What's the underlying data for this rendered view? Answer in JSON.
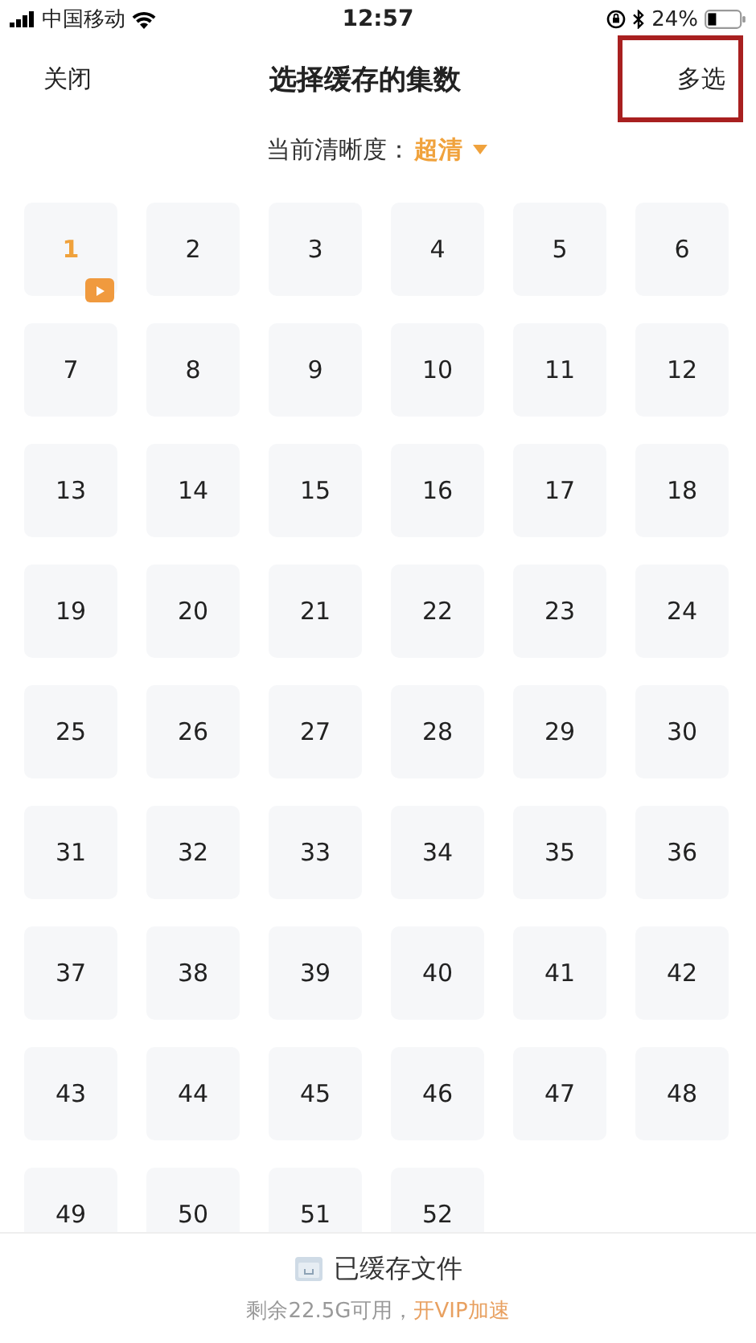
{
  "status_bar": {
    "carrier": "中国移动",
    "time": "12:57",
    "battery": "24%"
  },
  "header": {
    "close": "关闭",
    "title": "选择缓存的集数",
    "multi_select": {
      "label": "多选",
      "highlighted": true
    }
  },
  "quality": {
    "label": "当前清晰度：",
    "value": "超清"
  },
  "episodes": [
    {
      "label": "1",
      "playing": true
    },
    {
      "label": "2",
      "playing": false
    },
    {
      "label": "3",
      "playing": false
    },
    {
      "label": "4",
      "playing": false
    },
    {
      "label": "5",
      "playing": false
    },
    {
      "label": "6",
      "playing": false
    },
    {
      "label": "7",
      "playing": false
    },
    {
      "label": "8",
      "playing": false
    },
    {
      "label": "9",
      "playing": false
    },
    {
      "label": "10",
      "playing": false
    },
    {
      "label": "11",
      "playing": false
    },
    {
      "label": "12",
      "playing": false
    },
    {
      "label": "13",
      "playing": false
    },
    {
      "label": "14",
      "playing": false
    },
    {
      "label": "15",
      "playing": false
    },
    {
      "label": "16",
      "playing": false
    },
    {
      "label": "17",
      "playing": false
    },
    {
      "label": "18",
      "playing": false
    },
    {
      "label": "19",
      "playing": false
    },
    {
      "label": "20",
      "playing": false
    },
    {
      "label": "21",
      "playing": false
    },
    {
      "label": "22",
      "playing": false
    },
    {
      "label": "23",
      "playing": false
    },
    {
      "label": "24",
      "playing": false
    },
    {
      "label": "25",
      "playing": false
    },
    {
      "label": "26",
      "playing": false
    },
    {
      "label": "27",
      "playing": false
    },
    {
      "label": "28",
      "playing": false
    },
    {
      "label": "29",
      "playing": false
    },
    {
      "label": "30",
      "playing": false
    },
    {
      "label": "31",
      "playing": false
    },
    {
      "label": "32",
      "playing": false
    },
    {
      "label": "33",
      "playing": false
    },
    {
      "label": "34",
      "playing": false
    },
    {
      "label": "35",
      "playing": false
    },
    {
      "label": "36",
      "playing": false
    },
    {
      "label": "37",
      "playing": false
    },
    {
      "label": "38",
      "playing": false
    },
    {
      "label": "39",
      "playing": false
    },
    {
      "label": "40",
      "playing": false
    },
    {
      "label": "41",
      "playing": false
    },
    {
      "label": "42",
      "playing": false
    },
    {
      "label": "43",
      "playing": false
    },
    {
      "label": "44",
      "playing": false
    },
    {
      "label": "45",
      "playing": false
    },
    {
      "label": "46",
      "playing": false
    },
    {
      "label": "47",
      "playing": false
    },
    {
      "label": "48",
      "playing": false
    },
    {
      "label": "49",
      "playing": false
    },
    {
      "label": "50",
      "playing": false
    },
    {
      "label": "51",
      "playing": false
    },
    {
      "label": "52",
      "playing": false
    }
  ],
  "footer": {
    "cached_files": "已缓存文件",
    "storage": "剩余22.5G可用，",
    "vip_link": "开VIP加速"
  }
}
